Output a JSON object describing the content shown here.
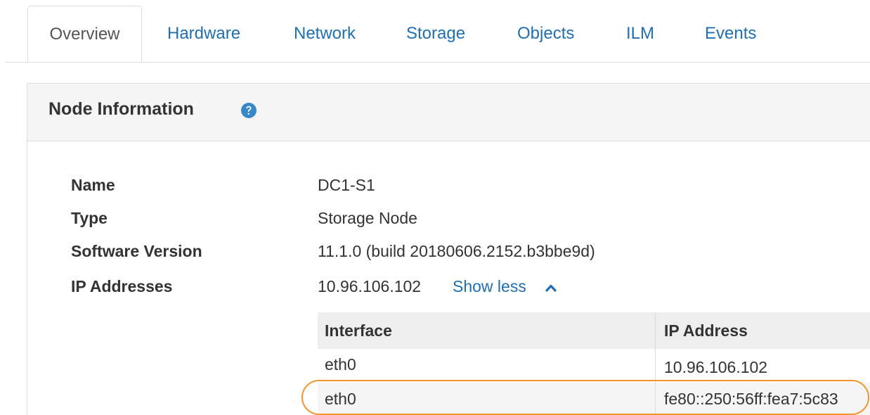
{
  "tabs": [
    {
      "label": "Overview",
      "active": true
    },
    {
      "label": "Hardware",
      "active": false
    },
    {
      "label": "Network",
      "active": false
    },
    {
      "label": "Storage",
      "active": false
    },
    {
      "label": "Objects",
      "active": false
    },
    {
      "label": "ILM",
      "active": false
    },
    {
      "label": "Events",
      "active": false
    }
  ],
  "panel": {
    "title": "Node Information",
    "help_icon": "question-circle-icon"
  },
  "info": {
    "name": {
      "label": "Name",
      "value": "DC1-S1"
    },
    "type": {
      "label": "Type",
      "value": "Storage Node"
    },
    "software_version": {
      "label": "Software Version",
      "value": "11.1.0 (build 20180606.2152.b3bbe9d)"
    },
    "ip_addresses": {
      "label": "IP Addresses",
      "value": "10.96.106.102",
      "toggle_label": "Show less",
      "toggle_icon": "chevron-up-icon"
    }
  },
  "ip_table": {
    "headers": [
      "Interface",
      "IP Address"
    ],
    "rows": [
      {
        "interface": "eth0",
        "ip": "10.96.106.102"
      },
      {
        "interface": "eth0",
        "ip": "fe80::250:56ff:fea7:5c83"
      }
    ]
  },
  "colors": {
    "link": "#1f6fb2",
    "heading_bg": "#f5f5f5",
    "border": "#dddddd",
    "highlight": "#f0962a",
    "help_icon": "#3a87c8"
  }
}
